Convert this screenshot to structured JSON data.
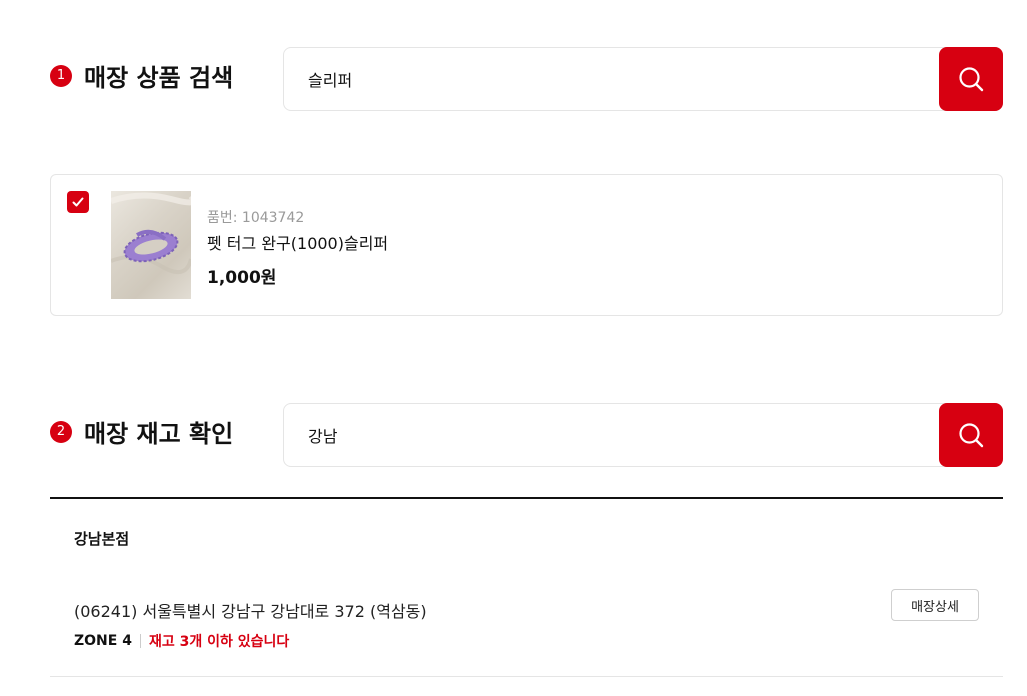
{
  "product_search": {
    "step_number": "1",
    "title": "매장 상품 검색",
    "query": "슬리퍼",
    "search_icon": "search-icon"
  },
  "product": {
    "checked": true,
    "sku_label": "품번: 1043742",
    "name": "펫 터그 완구(1000)슬리퍼",
    "price": "1,000원",
    "thumbnail": "purple-rope-slipper-toy-photo"
  },
  "stock_check": {
    "step_number": "2",
    "title": "매장 재고 확인",
    "query": "강남",
    "search_icon": "search-icon"
  },
  "store": {
    "name": "강남본점",
    "address": "(06241) 서울특별시 강남구 강남대로 372 (역삼동)",
    "zone": "ZONE 4",
    "stock_status": "재고 3개 이하 있습니다",
    "detail_button": "매장상세"
  },
  "colors": {
    "accent": "#d70011",
    "border": "#e5e5e5",
    "text": "#111111"
  }
}
